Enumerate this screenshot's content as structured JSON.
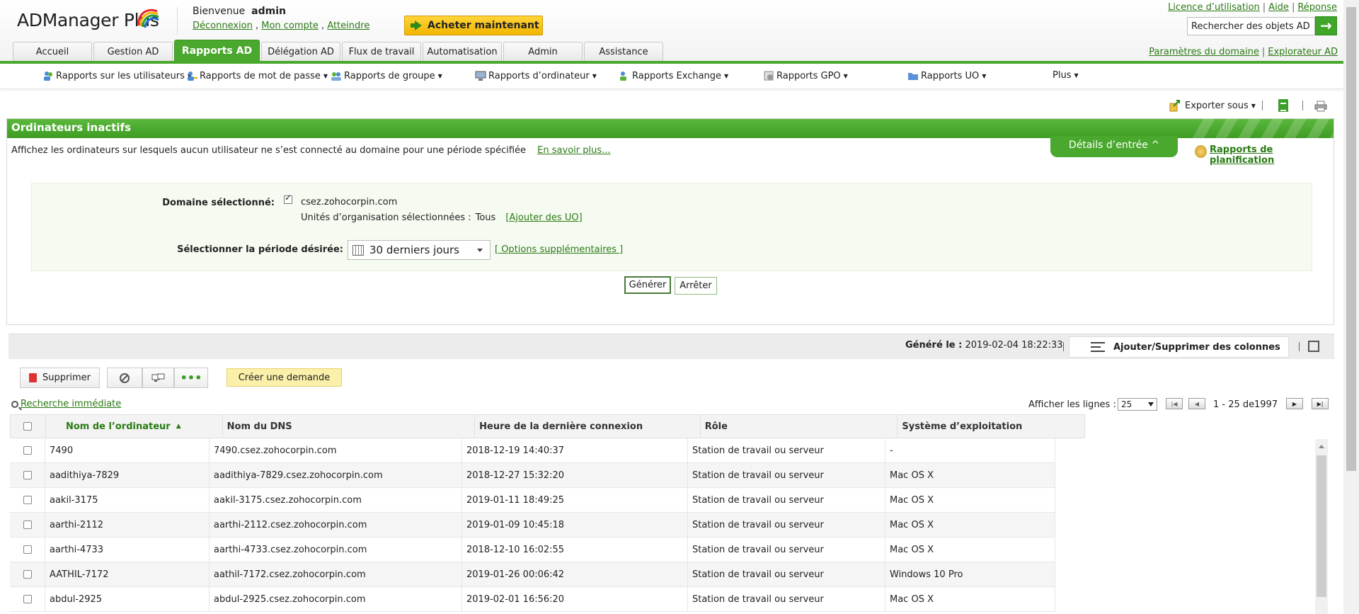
{
  "app": {
    "logo": "ADManager Plus"
  },
  "header": {
    "welcome_prefix": "Bienvenue",
    "user": "admin",
    "links": [
      "Déconnexion",
      "Mon compte",
      "Atteindre"
    ],
    "buy_label": "Acheter maintenant",
    "top_links": [
      "Licence d’utilisation",
      "Aide",
      "Réponse"
    ],
    "search_value": "Rechercher des objets AD",
    "search_button": "→",
    "right_links": [
      "Paramètres du domaine",
      "Explorateur AD"
    ]
  },
  "tabs": [
    {
      "label": "Accueil",
      "width": 112
    },
    {
      "label": "Gestion AD",
      "width": 112
    },
    {
      "label": "Rapports AD",
      "width": 121,
      "active": true
    },
    {
      "label": "Délégation AD",
      "width": 112
    },
    {
      "label": "Flux de travail",
      "width": 112
    },
    {
      "label": "Automatisation",
      "width": 112
    },
    {
      "label": "Admin",
      "width": 112
    },
    {
      "label": "Assistance",
      "width": 112
    }
  ],
  "submenu": [
    "Rapports sur les utilisateurs",
    "Rapports de mot de passe",
    "Rapports de groupe",
    "Rapports d’ordinateur",
    "Rapports Exchange",
    "Rapports GPO",
    "Rapports UO",
    "Plus"
  ],
  "toolbar": {
    "export_label": "Exporter sous"
  },
  "report": {
    "title": "Ordinateurs inactifs",
    "description": "Affichez les ordinateurs sur lesquels aucun utilisateur ne s’est connecté au domaine pour une période spécifiée",
    "learn_more": "En savoir plus...",
    "details_tab": "Détails d’entrée ^",
    "schedule_link": "Rapports de planification",
    "domain_label": "Domaine sélectionné:",
    "domain_value": "csez.zohocorpin.com",
    "ou_label": "Unités d’organisation sélectionnées :",
    "ou_value": "Tous",
    "ou_add": "[Ajouter des UO]",
    "period_label": "Sélectionner la période désirée:",
    "period_value": "30 derniers jours",
    "more_options": "[ Options supplémentaires ]",
    "generate": "Générer",
    "stop": "Arrêter"
  },
  "results": {
    "generated_label": "Généré le :",
    "generated_value": "2019-02-04 18:22:33",
    "columns_button": "Ajouter/Supprimer des colonnes",
    "delete": "Supprimer",
    "create_request": "Créer une demande",
    "quick_search": "Recherche immédiate",
    "rows_label": "Afficher les lignes :",
    "rows_value": "25",
    "range": "1 - 25 de",
    "total": "1997"
  },
  "table": {
    "headers": [
      "Nom de l’ordinateur",
      "Nom du DNS",
      "Heure de la dernière connexion",
      "Rôle",
      "Système d’exploitation"
    ],
    "rows": [
      [
        "7490",
        "7490.csez.zohocorpin.com",
        "2018-12-19 14:40:37",
        "Station de travail ou serveur",
        "-"
      ],
      [
        "aadithiya-7829",
        "aadithiya-7829.csez.zohocorpin.com",
        "2018-12-27 15:32:20",
        "Station de travail ou serveur",
        "Mac OS X"
      ],
      [
        "aakil-3175",
        "aakil-3175.csez.zohocorpin.com",
        "2019-01-11 18:49:25",
        "Station de travail ou serveur",
        "Mac OS X"
      ],
      [
        "aarthi-2112",
        "aarthi-2112.csez.zohocorpin.com",
        "2019-01-09 10:45:18",
        "Station de travail ou serveur",
        "Mac OS X"
      ],
      [
        "aarthi-4733",
        "aarthi-4733.csez.zohocorpin.com",
        "2018-12-10 16:02:55",
        "Station de travail ou serveur",
        "Mac OS X"
      ],
      [
        "AATHIL-7172",
        "aathil-7172.csez.zohocorpin.com",
        "2019-01-26 00:06:42",
        "Station de travail ou serveur",
        "Windows 10 Pro"
      ],
      [
        "abdul-2925",
        "abdul-2925.csez.zohocorpin.com",
        "2019-02-01 16:56:20",
        "Station de travail ou serveur",
        "Mac OS X"
      ]
    ]
  },
  "colors": {
    "brand_green": "#4aa82e",
    "link_green": "#2a7a14",
    "buy_yellow": "#f2b600"
  }
}
